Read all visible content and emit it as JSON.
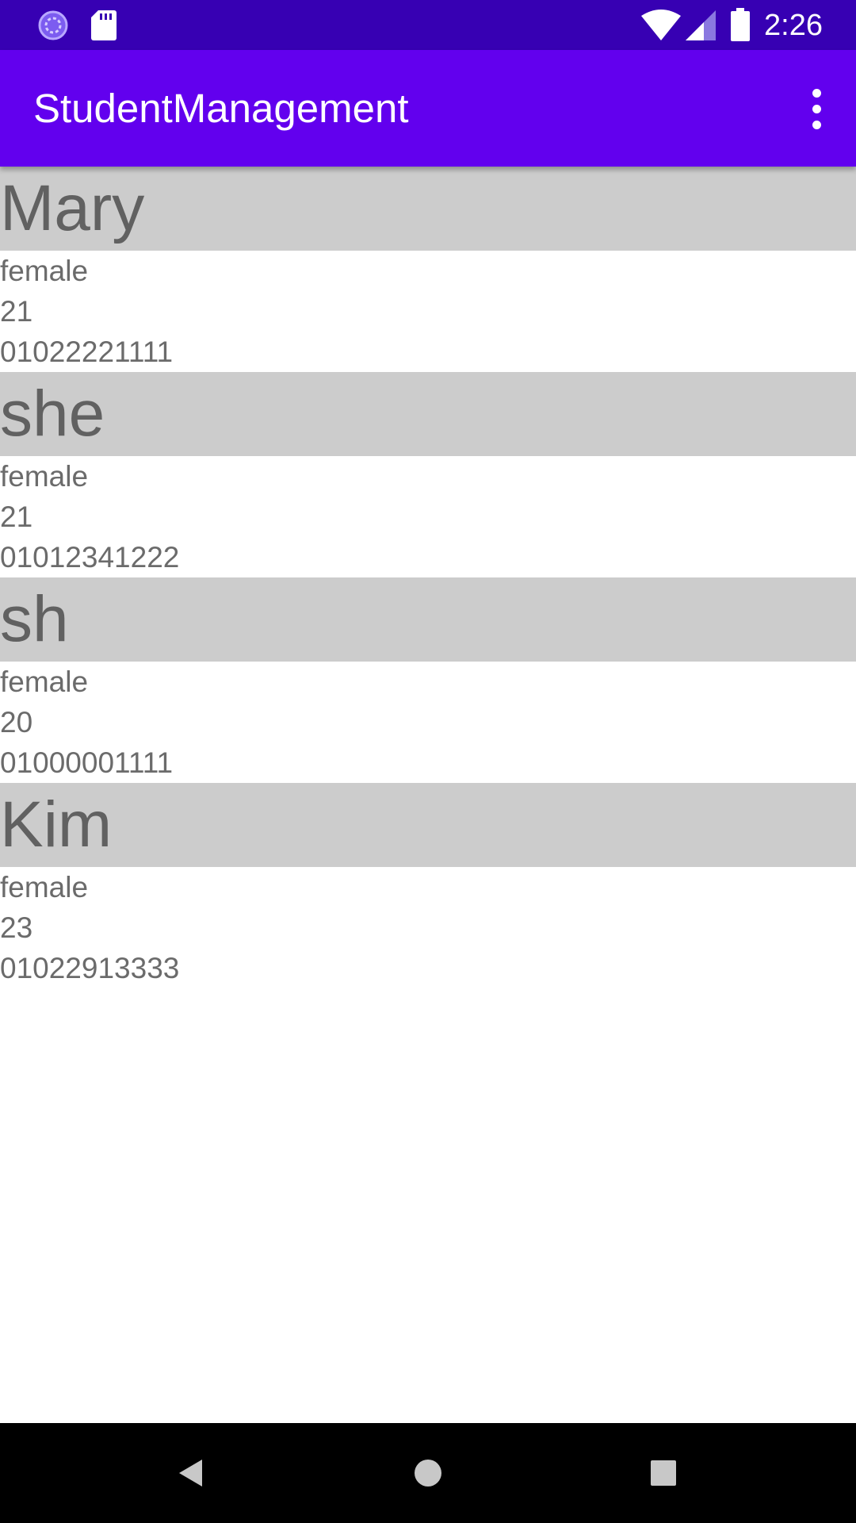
{
  "status_bar": {
    "time": "2:26",
    "icons": [
      "sync-icon",
      "sd-card-icon",
      "wifi-icon",
      "cellular-signal-icon",
      "battery-icon"
    ]
  },
  "app_bar": {
    "title": "StudentManagement",
    "overflow_icon": "more-vert-icon"
  },
  "students": [
    {
      "name": "Mary",
      "gender": "female",
      "age": "21",
      "phone": "01022221111"
    },
    {
      "name": "she",
      "gender": "female",
      "age": "21",
      "phone": "01012341222"
    },
    {
      "name": "sh",
      "gender": "female",
      "age": "20",
      "phone": "01000001111"
    },
    {
      "name": "Kim",
      "gender": "female",
      "age": "23",
      "phone": "01022913333"
    }
  ],
  "nav_bar": {
    "icons": [
      "back-icon",
      "home-icon",
      "recents-icon"
    ]
  },
  "colors": {
    "status_bar": "#3700b3",
    "app_bar": "#6200ee",
    "name_band": "#cccccc",
    "name_text": "#616161",
    "detail_text": "#6b6b6b",
    "nav_bar": "#000000"
  }
}
